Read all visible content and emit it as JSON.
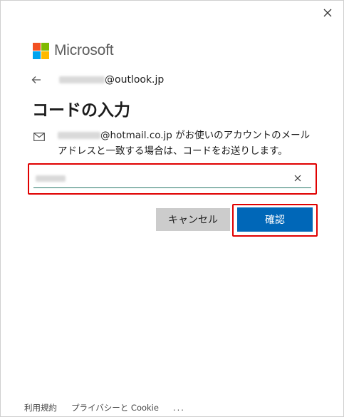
{
  "window": {
    "close_label": "×"
  },
  "brand": {
    "name": "Microsoft",
    "colors": {
      "red": "#f25022",
      "green": "#7fba00",
      "blue": "#00a4ef",
      "yellow": "#ffb900"
    }
  },
  "account": {
    "email_domain": "@outlook.jp"
  },
  "page": {
    "title": "コードの入力",
    "description_domain": "@hotmail.co.jp",
    "description_text": " がお使いのアカウントのメール アドレスと一致する場合は、コードをお送りします。"
  },
  "code_input": {
    "clear_label": "×"
  },
  "buttons": {
    "cancel": "キャンセル",
    "confirm": "確認"
  },
  "footer": {
    "terms": "利用規約",
    "privacy": "プライバシーと Cookie",
    "more": "..."
  },
  "colors": {
    "primary": "#0067b8",
    "highlight": "#e00000",
    "secondary_button": "#cccccc"
  }
}
